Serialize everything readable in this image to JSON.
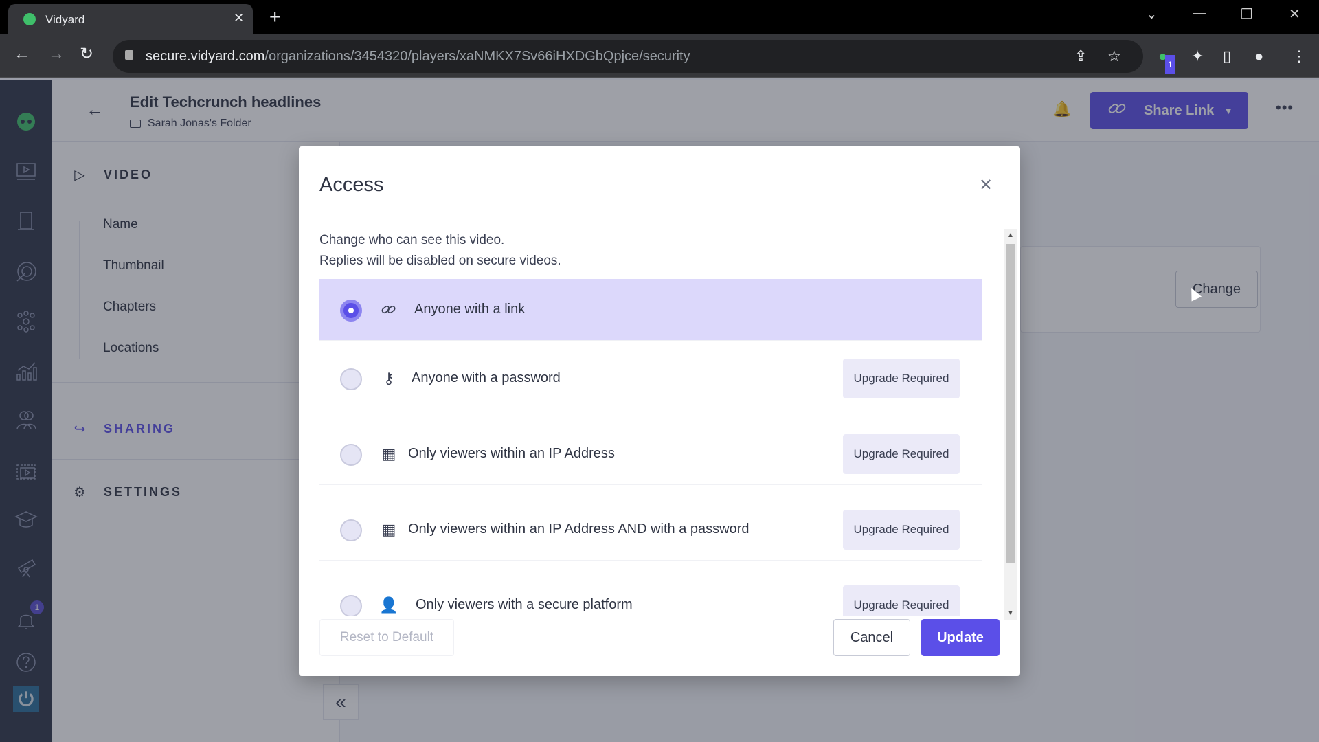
{
  "browser": {
    "tab_title": "Vidyard",
    "tab_close": "✕",
    "new_tab": "+",
    "url_host": "secure.vidyard.com",
    "url_path": "/organizations/3454320/players/xaNMKX7Sv66iHXDGbQpjce/security",
    "extension_badge": "1",
    "icons": {
      "back": "←",
      "forward": "→",
      "reload": "↻",
      "share": "⇪",
      "star": "☆",
      "extensions": "✦",
      "sidepanel": "▯",
      "profile": "●",
      "menu": "⋮",
      "tab_list": "⌄",
      "minimize": "—",
      "restore": "❐",
      "close": "✕"
    }
  },
  "rail": {
    "notification_badge": "1"
  },
  "header": {
    "back_icon": "←",
    "title": "Edit Techcrunch headlines",
    "folder": "Sarah Jonas's Folder",
    "bell_icon": "🔔",
    "share_label": "Share Link",
    "share_caret": "▼",
    "more_icon": "•••"
  },
  "sidenav": {
    "sections": [
      {
        "label": "VIDEO",
        "icon": "▷"
      },
      {
        "label": "SHARING",
        "icon": "↪"
      },
      {
        "label": "SETTINGS",
        "icon": "⚙"
      }
    ],
    "video_items": [
      "Name",
      "Thumbnail",
      "Chapters",
      "Locations"
    ],
    "collapse_icon": "«"
  },
  "content": {
    "change_label": "Change"
  },
  "modal": {
    "title": "Access",
    "close_icon": "✕",
    "description_1": "Change who can see this video.",
    "description_2": "Replies will be disabled on secure videos.",
    "options": [
      {
        "label": "Anyone with a link",
        "icon": "🔗",
        "selected": true,
        "badge": ""
      },
      {
        "label": "Anyone with a password",
        "icon": "⚷",
        "selected": false,
        "badge": "Upgrade Required"
      },
      {
        "label": "Only viewers within an IP Address",
        "icon": "▦",
        "selected": false,
        "badge": "Upgrade Required"
      },
      {
        "label": "Only viewers within an IP Address AND with a password",
        "icon": "▦",
        "selected": false,
        "badge": "Upgrade Required"
      },
      {
        "label": "Only viewers with a secure platform",
        "icon": "👤",
        "selected": false,
        "badge": "Upgrade Required"
      }
    ],
    "reset_label": "Reset to Default",
    "cancel_label": "Cancel",
    "update_label": "Update",
    "scroll_up": "▲",
    "scroll_down": "▼"
  },
  "colors": {
    "accent": "#5b4fe8",
    "selected_row": "#dcd8fb",
    "rail": "#2f3547"
  }
}
